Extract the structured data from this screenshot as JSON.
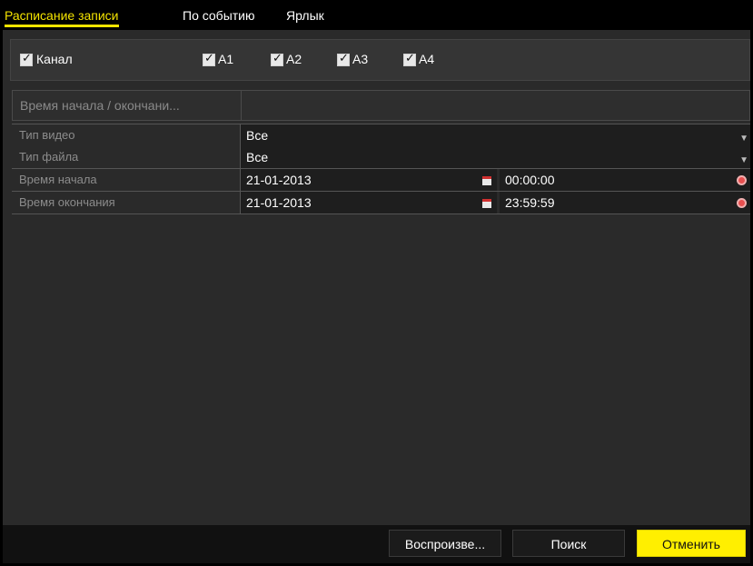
{
  "tabs": [
    "Расписание записи",
    "По событию",
    "Ярлык"
  ],
  "channel": {
    "label": "Канал",
    "items": [
      "A1",
      "A2",
      "A3",
      "A4"
    ]
  },
  "time_header": "Время начала / окончани...",
  "form": {
    "video_type": {
      "label": "Тип видео",
      "value": "Все"
    },
    "file_type": {
      "label": "Тип файла",
      "value": "Все"
    },
    "start_time": {
      "label": "Время начала",
      "date": "21-01-2013",
      "time": "00:00:00"
    },
    "end_time": {
      "label": "Время окончания",
      "date": "21-01-2013",
      "time": "23:59:59"
    }
  },
  "buttons": {
    "play": "Воспроизве...",
    "search": "Поиск",
    "cancel": "Отменить"
  },
  "colors": {
    "accent": "#ffef00",
    "background": "#2a2a2a"
  },
  "icons": [
    "checkbox-checked-icon",
    "dropdown-arrow-icon",
    "calendar-icon",
    "clock-icon"
  ]
}
